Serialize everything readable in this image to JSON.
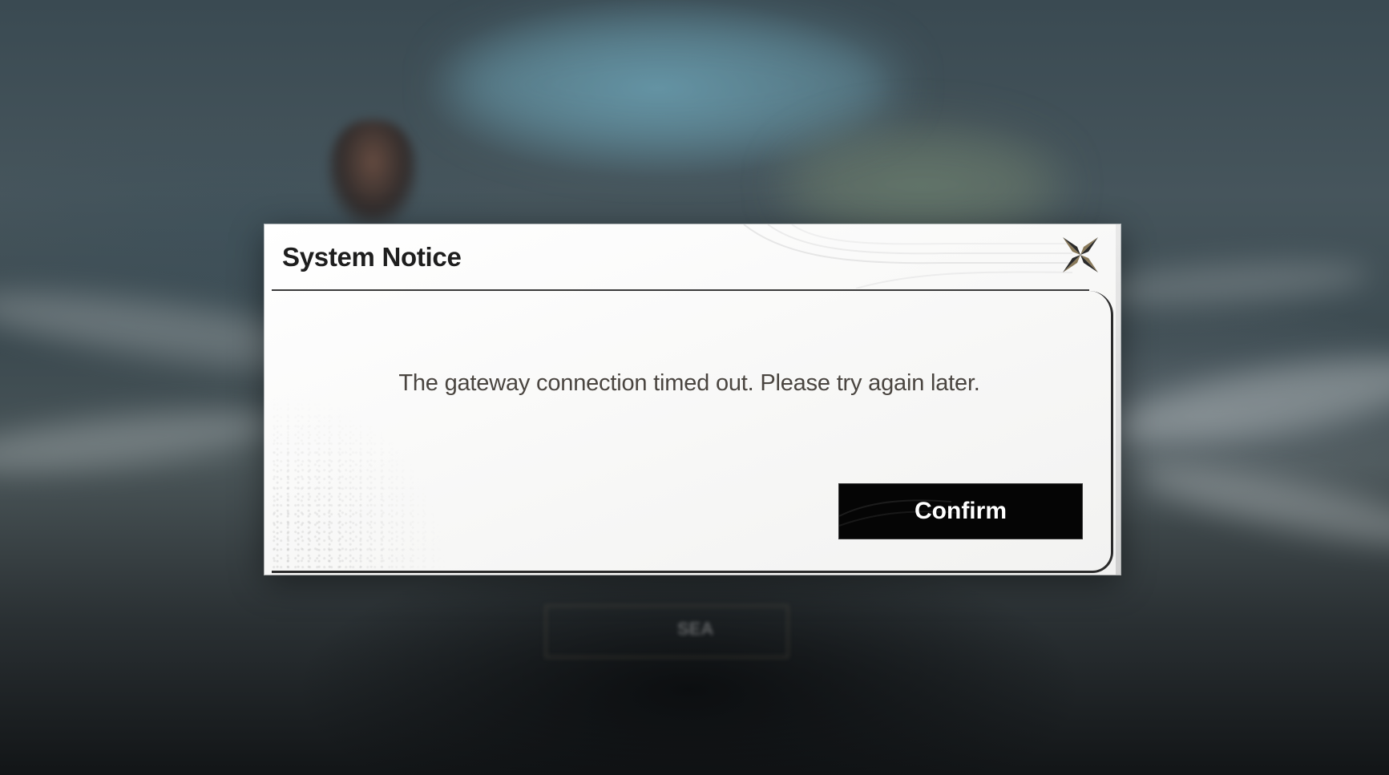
{
  "dialog": {
    "title": "System Notice",
    "message": "The gateway connection timed out. Please try again later.",
    "confirm_label": "Confirm",
    "close_icon": "close-x-icon"
  },
  "background": {
    "blurred_text": "SEA"
  },
  "colors": {
    "dialog_bg": "#f7f7f6",
    "title_text": "#1e1e1e",
    "message_text": "#4a4540",
    "button_bg": "#050505",
    "button_text": "#ffffff",
    "close_icon": "#8a7a5a"
  }
}
